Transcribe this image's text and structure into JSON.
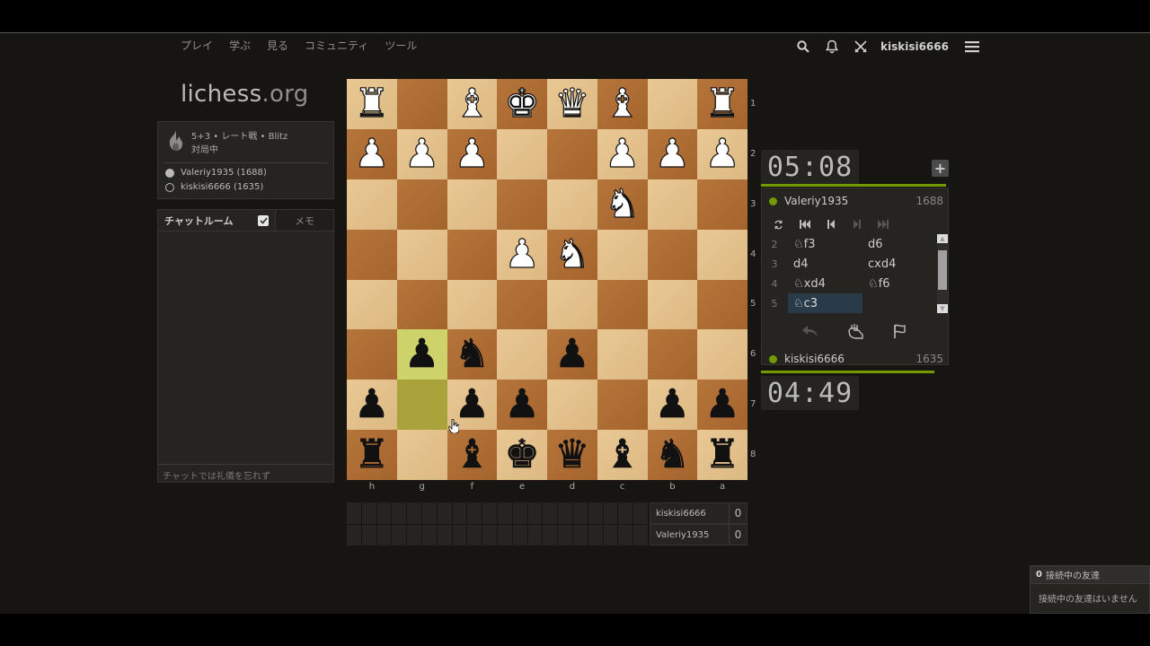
{
  "site": {
    "logo_main": "lichess",
    "logo_tld": ".org",
    "nav": [
      "プレイ",
      "学ぶ",
      "見る",
      "コミュニティ",
      "ツール"
    ],
    "username": "kiskisi6666",
    "icons": [
      "search-icon",
      "bell-icon",
      "swords-icon",
      "hamburger-icon"
    ]
  },
  "game_info": {
    "line1": "5+3 • レート戦 • Blitz",
    "line2": "対局中",
    "players": [
      "Valeriy1935 (1688)",
      "kiskisi6666 (1635)"
    ]
  },
  "chat": {
    "tab_room": "チャットルーム",
    "tab_memo": "メモ",
    "placeholder": "チャットでは礼儀を忘れず"
  },
  "board": {
    "orientation": "black",
    "ranks": [
      "1",
      "2",
      "3",
      "4",
      "5",
      "6",
      "7",
      "8"
    ],
    "files": [
      "h",
      "g",
      "f",
      "e",
      "d",
      "c",
      "b",
      "a"
    ],
    "squares": [
      [
        "R",
        "",
        "B",
        "K",
        "Q",
        "B",
        "",
        "R"
      ],
      [
        "P",
        "P",
        "P",
        "",
        "",
        "P",
        "P",
        "P"
      ],
      [
        "",
        "",
        "",
        "",
        "",
        "N",
        "",
        ""
      ],
      [
        "",
        "",
        "",
        "P",
        "N",
        "",
        "",
        ""
      ],
      [
        "",
        "",
        "",
        "",
        "",
        "",
        "",
        ""
      ],
      [
        "",
        "p",
        "n",
        "",
        "p",
        "",
        "",
        ""
      ],
      [
        "p",
        "",
        "p",
        "p",
        "",
        "",
        "p",
        "p"
      ],
      [
        "r",
        "",
        "b",
        "k",
        "q",
        "b",
        "n",
        "r"
      ]
    ],
    "last_move": [
      [
        5,
        1
      ],
      [
        6,
        1
      ]
    ]
  },
  "material": {
    "rows": [
      {
        "name": "kiskisi6666",
        "score": "0"
      },
      {
        "name": "Valeriy1935",
        "score": "0"
      }
    ]
  },
  "panel": {
    "clock_top": "05:08",
    "clock_bottom": "04:49",
    "top_player": {
      "name": "Valeriy1935",
      "rating": "1688"
    },
    "bottom_player": {
      "name": "kiskisi6666",
      "rating": "1635"
    },
    "moves": [
      {
        "n": "2",
        "w": "♘f3",
        "b": "d6"
      },
      {
        "n": "3",
        "w": "d4",
        "b": "cxd4"
      },
      {
        "n": "4",
        "w": "♘xd4",
        "b": "♘f6"
      },
      {
        "n": "5",
        "w": "♘c3",
        "b": ""
      }
    ],
    "accent": "#759900"
  },
  "friends": {
    "count": "0",
    "header": "接続中の友達",
    "empty": "接続中の友達はいません"
  }
}
